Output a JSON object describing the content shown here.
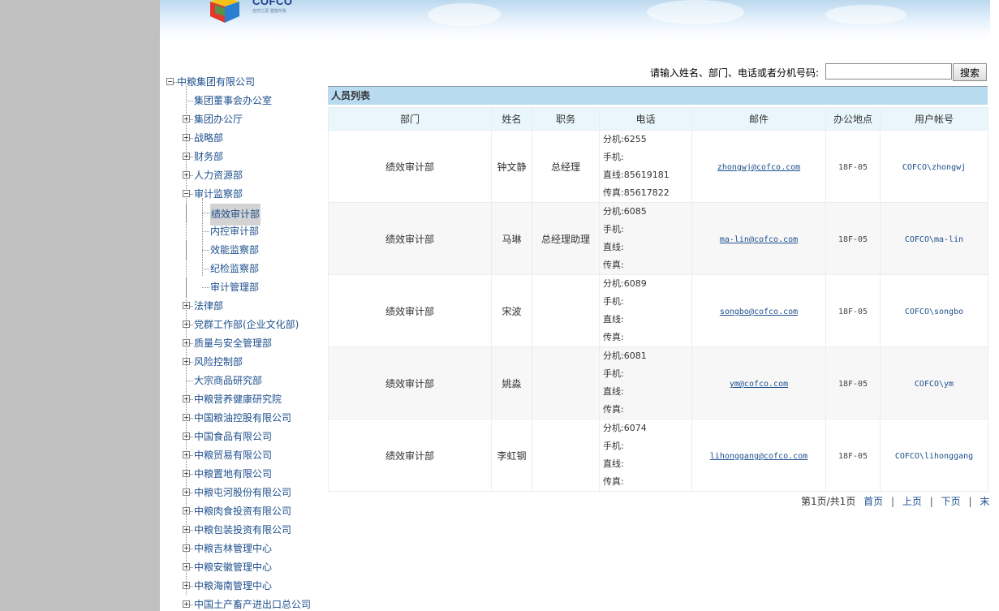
{
  "logo": {
    "text": "COFCO",
    "slogan": "自然之源 重塑你我"
  },
  "tree": {
    "root": "中粮集团有限公司",
    "items": [
      "集团董事会办公室",
      "集团办公厅",
      "战略部",
      "财务部",
      "人力资源部",
      "审计监察部",
      "绩效审计部",
      "内控审计部",
      "效能监察部",
      "纪检监察部",
      "审计管理部",
      "法律部",
      "党群工作部(企业文化部)",
      "质量与安全管理部",
      "风险控制部",
      "大宗商品研究部",
      "中粮营养健康研究院",
      "中国粮油控股有限公司",
      "中国食品有限公司",
      "中粮贸易有限公司",
      "中粮置地有限公司",
      "中粮屯河股份有限公司",
      "中粮肉食投资有限公司",
      "中粮包装投资有限公司",
      "中粮吉林管理中心",
      "中粮安徽管理中心",
      "中粮海南管理中心",
      "中国土产畜产进出口总公司"
    ]
  },
  "search": {
    "label": "请输入姓名、部门、电话或者分机号码:",
    "value": "",
    "button": "搜索"
  },
  "list": {
    "title": "人员列表",
    "columns": [
      "部门",
      "姓名",
      "职务",
      "电话",
      "邮件",
      "办公地点",
      "用户帐号"
    ],
    "rows": [
      {
        "dept": "绩效审计部",
        "name": "钟文静",
        "title": "总经理",
        "ext": "分机:6255",
        "mobile": "手机:",
        "direct": "直线:85619181",
        "fax": "传真:85617822",
        "email": "zhongwj@cofco.com",
        "location": "18F-05",
        "account": "COFCO\\zhongwj"
      },
      {
        "dept": "绩效审计部",
        "name": "马琳",
        "title": "总经理助理",
        "ext": "分机:6085",
        "mobile": "手机:",
        "direct": "直线:",
        "fax": "传真:",
        "email": "ma-lin@cofco.com",
        "location": "18F-05",
        "account": "COFCO\\ma-lin"
      },
      {
        "dept": "绩效审计部",
        "name": "宋波",
        "title": "",
        "ext": "分机:6089",
        "mobile": "手机:",
        "direct": "直线:",
        "fax": "传真:",
        "email": "songbo@cofco.com",
        "location": "18F-05",
        "account": "COFCO\\songbo"
      },
      {
        "dept": "绩效审计部",
        "name": "姚淼",
        "title": "",
        "ext": "分机:6081",
        "mobile": "手机:",
        "direct": "直线:",
        "fax": "传真:",
        "email": "ym@cofco.com",
        "location": "18F-05",
        "account": "COFCO\\ym"
      },
      {
        "dept": "绩效审计部",
        "name": "李虹钢",
        "title": "",
        "ext": "分机:6074",
        "mobile": "手机:",
        "direct": "直线:",
        "fax": "传真:",
        "email": "lihonggang@cofco.com",
        "location": "18F-05",
        "account": "COFCO\\lihonggang"
      }
    ]
  },
  "pager": {
    "info": "第1页/共1页",
    "first": "首页",
    "prev": "上页",
    "next": "下页",
    "last": "末页"
  },
  "colors": {
    "link": "#1d4f8c",
    "title_bar": "#b9dbf0",
    "header_row": "#e9f6fb"
  }
}
